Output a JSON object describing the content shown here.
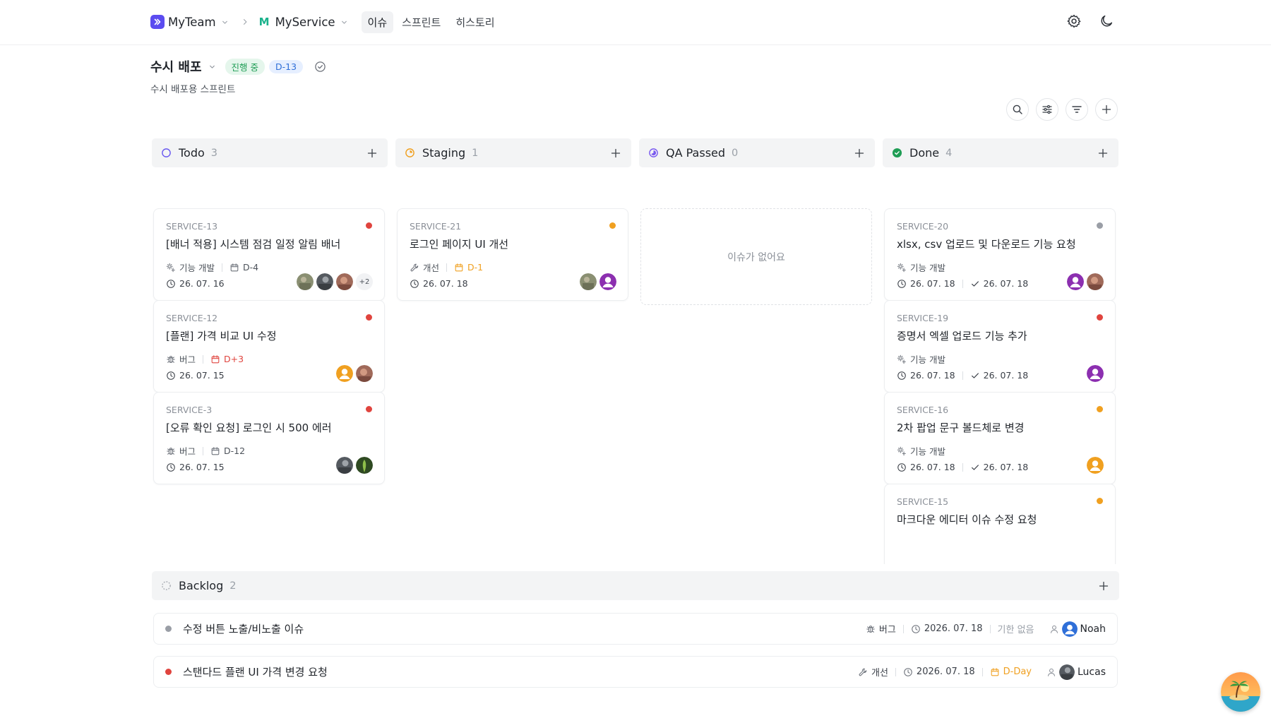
{
  "nav": {
    "team": "MyTeam",
    "service": "MyService",
    "service_letter": "M",
    "tabs": [
      {
        "label": "이슈",
        "active": true
      },
      {
        "label": "스프린트",
        "active": false
      },
      {
        "label": "히스토리",
        "active": false
      }
    ]
  },
  "sprint": {
    "title": "수시 배포",
    "status_badge": "진행 중",
    "dday_badge": "D-13",
    "subtitle": "수시 배포용 스프린트"
  },
  "columns": [
    {
      "title": "Todo",
      "count": "3",
      "cards": [
        {
          "id": "SERVICE-13",
          "title": "[배너 적용] 시스템 점검 일정 알림 배너",
          "type": "기능 개발",
          "due": "D-4",
          "due_color": "normal",
          "date": "26. 07. 16",
          "priority": "#e0443e",
          "more": "+2"
        },
        {
          "id": "SERVICE-12",
          "title": "[플랜] 가격 비교 UI 수정",
          "type": "버그",
          "due": "D+3",
          "due_color": "red",
          "date": "26. 07. 15",
          "priority": "#e0443e"
        },
        {
          "id": "SERVICE-3",
          "title": "[오류 확인 요청] 로그인 시 500 에러",
          "type": "버그",
          "due": "D-12",
          "due_color": "normal",
          "date": "26. 07. 15",
          "priority": "#e0443e"
        }
      ]
    },
    {
      "title": "Staging",
      "count": "1",
      "cards": [
        {
          "id": "SERVICE-21",
          "title": "로그인 페이지 UI 개선",
          "type": "개선",
          "due": "D-1",
          "due_color": "orange",
          "date": "26. 07. 18",
          "priority": "#f0a020"
        }
      ]
    },
    {
      "title": "QA Passed",
      "count": "0",
      "empty_text": "이슈가 없어요"
    },
    {
      "title": "Done",
      "count": "4",
      "cards": [
        {
          "id": "SERVICE-20",
          "title": "xlsx, csv 업로드 및 다운로드 기능 요청",
          "type": "기능 개발",
          "date": "26. 07. 18",
          "done_date": "26. 07. 18",
          "priority": "#9a9ea6"
        },
        {
          "id": "SERVICE-19",
          "title": "증명서 엑셀 업로드 기능 추가",
          "type": "기능 개발",
          "date": "26. 07. 18",
          "done_date": "26. 07. 18",
          "priority": "#e0443e"
        },
        {
          "id": "SERVICE-16",
          "title": "2차 팝업 문구 볼드체로 변경",
          "type": "기능 개발",
          "date": "26. 07. 18",
          "done_date": "26. 07. 18",
          "priority": "#f0a020"
        },
        {
          "id": "SERVICE-15",
          "title": "마크다운 에디터 이슈 수정 요청",
          "priority": "#f0a020"
        }
      ]
    }
  ],
  "backlog": {
    "title": "Backlog",
    "count": "2",
    "rows": [
      {
        "title": "수정 버튼 노출/비노출 이슈",
        "type": "버그",
        "date": "2026. 07. 18",
        "due": "기한 없음",
        "assignee": "Noah",
        "priority": "#9a9ea6"
      },
      {
        "title": "스탠다드 플랜 UI 가격 변경 요청",
        "type": "개선",
        "date": "2026. 07. 18",
        "due": "D-Day",
        "assignee": "Lucas",
        "priority": "#e0443e"
      }
    ]
  },
  "colors": {
    "accent": "#5b4cf0",
    "service": "#1bb28c",
    "red": "#e0443e",
    "orange": "#f0a020"
  }
}
